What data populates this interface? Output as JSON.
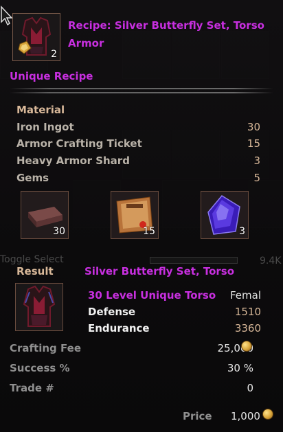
{
  "header": {
    "title": "Recipe: Silver Butterfly Set, Torso Armor",
    "icon": "armor-torso-icon",
    "icon_quantity": "2"
  },
  "rarity": "Unique Recipe",
  "materials": {
    "label": "Material",
    "items": [
      {
        "name": "Iron Ingot",
        "value": "30"
      },
      {
        "name": "Armor Crafting Ticket",
        "value": "15"
      },
      {
        "name": "Heavy Armor Shard",
        "value": "3"
      },
      {
        "name": "Gems",
        "value": "5"
      }
    ],
    "slots": [
      {
        "icon": "iron-ingot-icon",
        "quantity": "30"
      },
      {
        "icon": "crafting-ticket-icon",
        "quantity": "15"
      },
      {
        "icon": "gem-icon",
        "quantity": "3"
      }
    ]
  },
  "background": {
    "toggle_label": "Toggle Select",
    "toggle_value": "9.4K"
  },
  "result": {
    "label": "Result",
    "name": "Silver Butterfly Set, Torso",
    "level_type": "30 Level Unique Torso",
    "gender": "Femal",
    "stats": [
      {
        "name": "Defense",
        "value": "1510"
      },
      {
        "name": "Endurance",
        "value": "3360"
      }
    ]
  },
  "crafting": {
    "fee_label": "Crafting Fee",
    "fee_value": "25,000",
    "success_label": "Success %",
    "success_value": "30 %",
    "trade_label": "Trade #",
    "trade_value": "0",
    "price_label": "Price",
    "price_value": "1,000"
  },
  "colors": {
    "unique": "#c82fe0",
    "accent": "#d8b899",
    "background": "#0c0a0d"
  }
}
